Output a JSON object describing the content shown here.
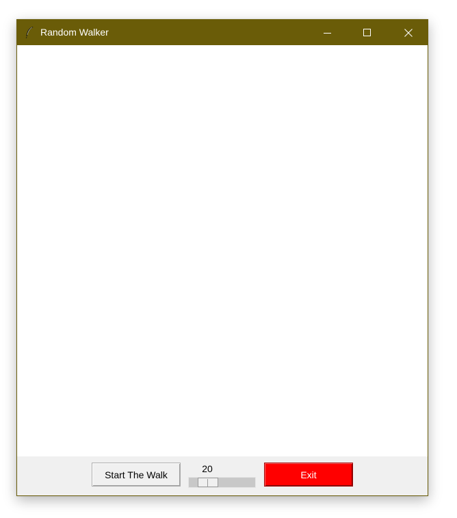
{
  "window": {
    "title": "Random Walker",
    "icon": "feather-icon",
    "accent_color": "#6a5c08"
  },
  "title_controls": {
    "minimize_icon": "minimize-icon",
    "maximize_icon": "maximize-icon",
    "close_icon": "close-icon"
  },
  "canvas": {
    "background": "#ffffff"
  },
  "controls": {
    "start_label": "Start The Walk",
    "speed_scale": {
      "value": "20",
      "min": 0,
      "max": 100,
      "current": 20
    },
    "exit_label": "Exit",
    "exit_color": "#ff0000"
  }
}
